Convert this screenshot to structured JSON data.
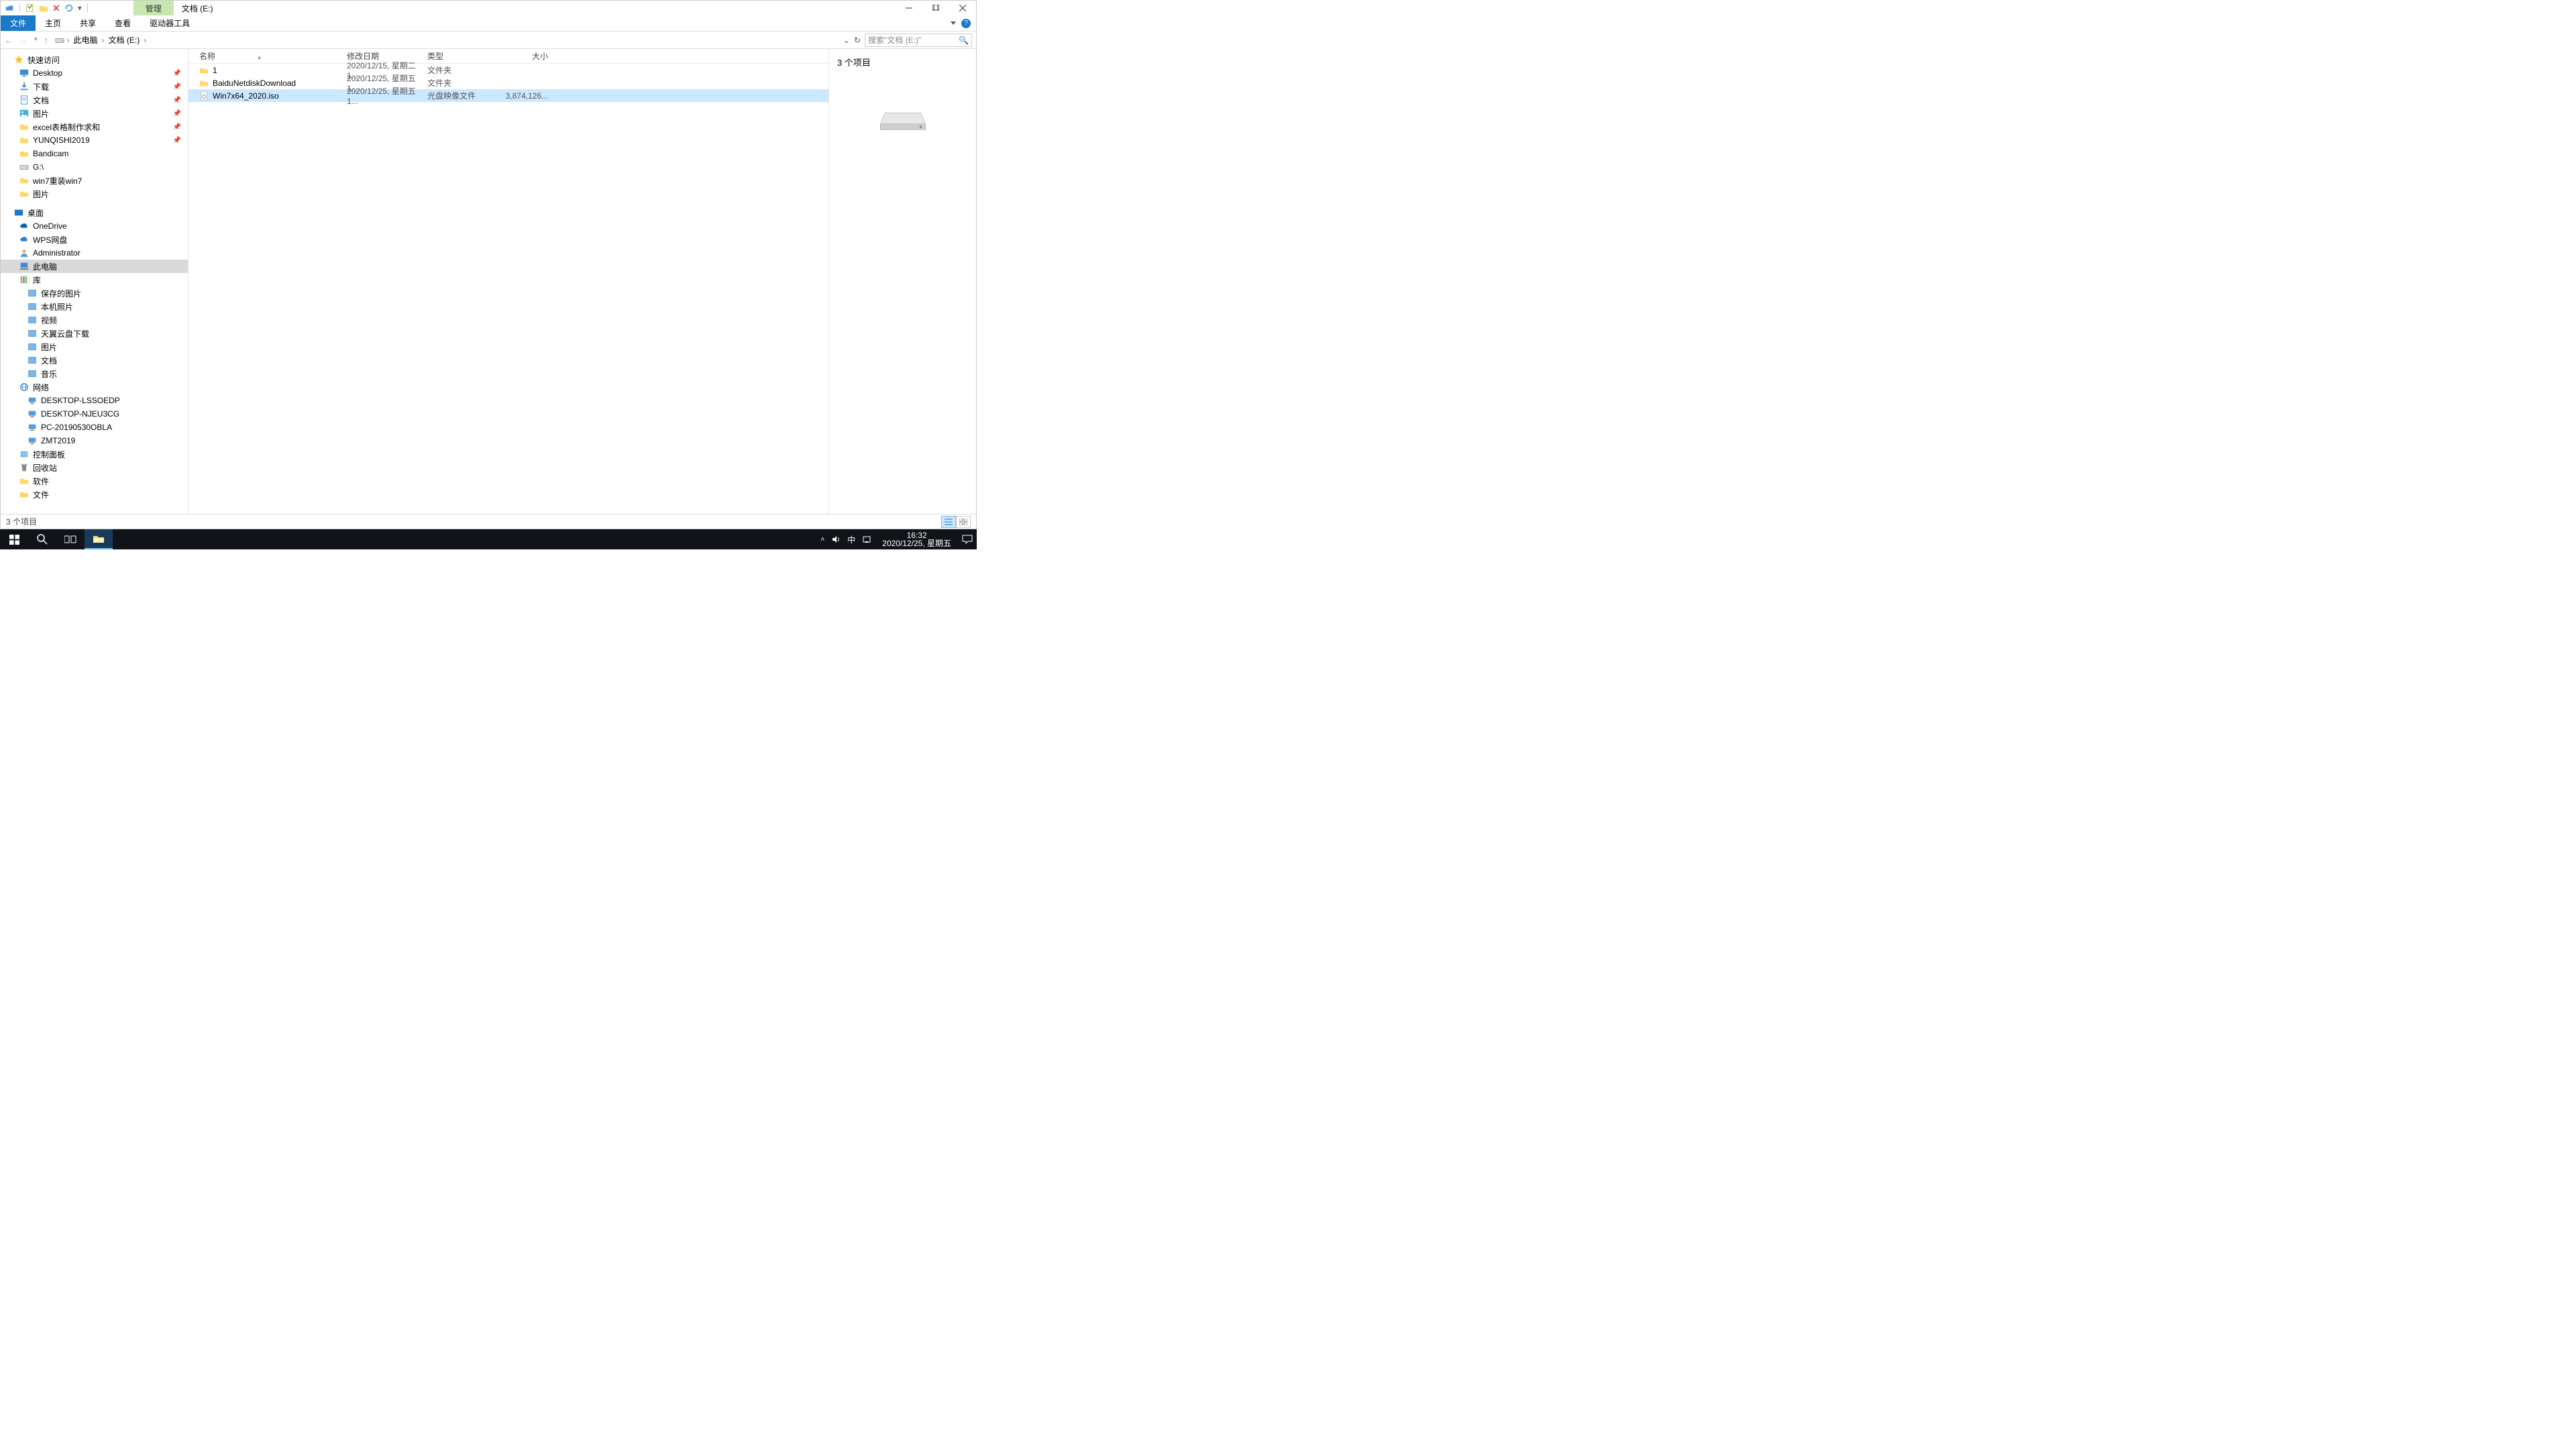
{
  "title_bar": {
    "context_tab": "管理",
    "window_title": "文档 (E:)"
  },
  "ribbon": {
    "file": "文件",
    "tabs": [
      "主页",
      "共享",
      "查看",
      "驱动器工具"
    ]
  },
  "address": {
    "crumbs": [
      "此电脑",
      "文档 (E:)"
    ],
    "search_placeholder": "搜索\"文档 (E:)\""
  },
  "tree": {
    "quick_access": {
      "label": "快速访问",
      "items": [
        {
          "label": "Desktop",
          "icon": "desktop",
          "pin": true
        },
        {
          "label": "下载",
          "icon": "download",
          "pin": true
        },
        {
          "label": "文档",
          "icon": "docs",
          "pin": true
        },
        {
          "label": "图片",
          "icon": "pictures",
          "pin": true
        },
        {
          "label": "excel表格制作求和",
          "icon": "folder",
          "pin": true
        },
        {
          "label": "YUNQISHI2019",
          "icon": "folder",
          "pin": true
        },
        {
          "label": "Bandicam",
          "icon": "folder"
        },
        {
          "label": "G:\\",
          "icon": "drive"
        },
        {
          "label": "win7重装win7",
          "icon": "folder"
        },
        {
          "label": "图片",
          "icon": "folder"
        }
      ]
    },
    "desktop": {
      "label": "桌面",
      "items": [
        {
          "label": "OneDrive",
          "icon": "onedrive"
        },
        {
          "label": "WPS网盘",
          "icon": "wps"
        },
        {
          "label": "Administrator",
          "icon": "user"
        },
        {
          "label": "此电脑",
          "icon": "pc",
          "selected": true
        },
        {
          "label": "库",
          "icon": "library",
          "items": [
            {
              "label": "保存的图片",
              "icon": "lib"
            },
            {
              "label": "本机照片",
              "icon": "lib"
            },
            {
              "label": "视频",
              "icon": "lib"
            },
            {
              "label": "天翼云盘下载",
              "icon": "lib"
            },
            {
              "label": "图片",
              "icon": "lib"
            },
            {
              "label": "文档",
              "icon": "lib"
            },
            {
              "label": "音乐",
              "icon": "lib"
            }
          ]
        },
        {
          "label": "网络",
          "icon": "network",
          "items": [
            {
              "label": "DESKTOP-LSSOEDP",
              "icon": "computer"
            },
            {
              "label": "DESKTOP-NJEU3CG",
              "icon": "computer"
            },
            {
              "label": "PC-20190530OBLA",
              "icon": "computer"
            },
            {
              "label": "ZMT2019",
              "icon": "computer"
            }
          ]
        },
        {
          "label": "控制面板",
          "icon": "control"
        },
        {
          "label": "回收站",
          "icon": "recycle"
        },
        {
          "label": "软件",
          "icon": "folder"
        },
        {
          "label": "文件",
          "icon": "folder"
        }
      ]
    }
  },
  "columns": {
    "name": "名称",
    "date": "修改日期",
    "type": "类型",
    "size": "大小"
  },
  "files": [
    {
      "name": "1",
      "date": "2020/12/15, 星期二 1...",
      "type": "文件夹",
      "size": "",
      "icon": "folder"
    },
    {
      "name": "BaiduNetdiskDownload",
      "date": "2020/12/25, 星期五 1...",
      "type": "文件夹",
      "size": "",
      "icon": "folder"
    },
    {
      "name": "Win7x64_2020.iso",
      "date": "2020/12/25, 星期五 1...",
      "type": "光盘映像文件",
      "size": "3,874,126...",
      "icon": "iso",
      "selected": true
    }
  ],
  "preview": {
    "count_label": "3 个项目"
  },
  "status": {
    "text": "3 个项目"
  },
  "taskbar": {
    "time": "16:32",
    "date": "2020/12/25, 星期五",
    "ime": "中"
  }
}
